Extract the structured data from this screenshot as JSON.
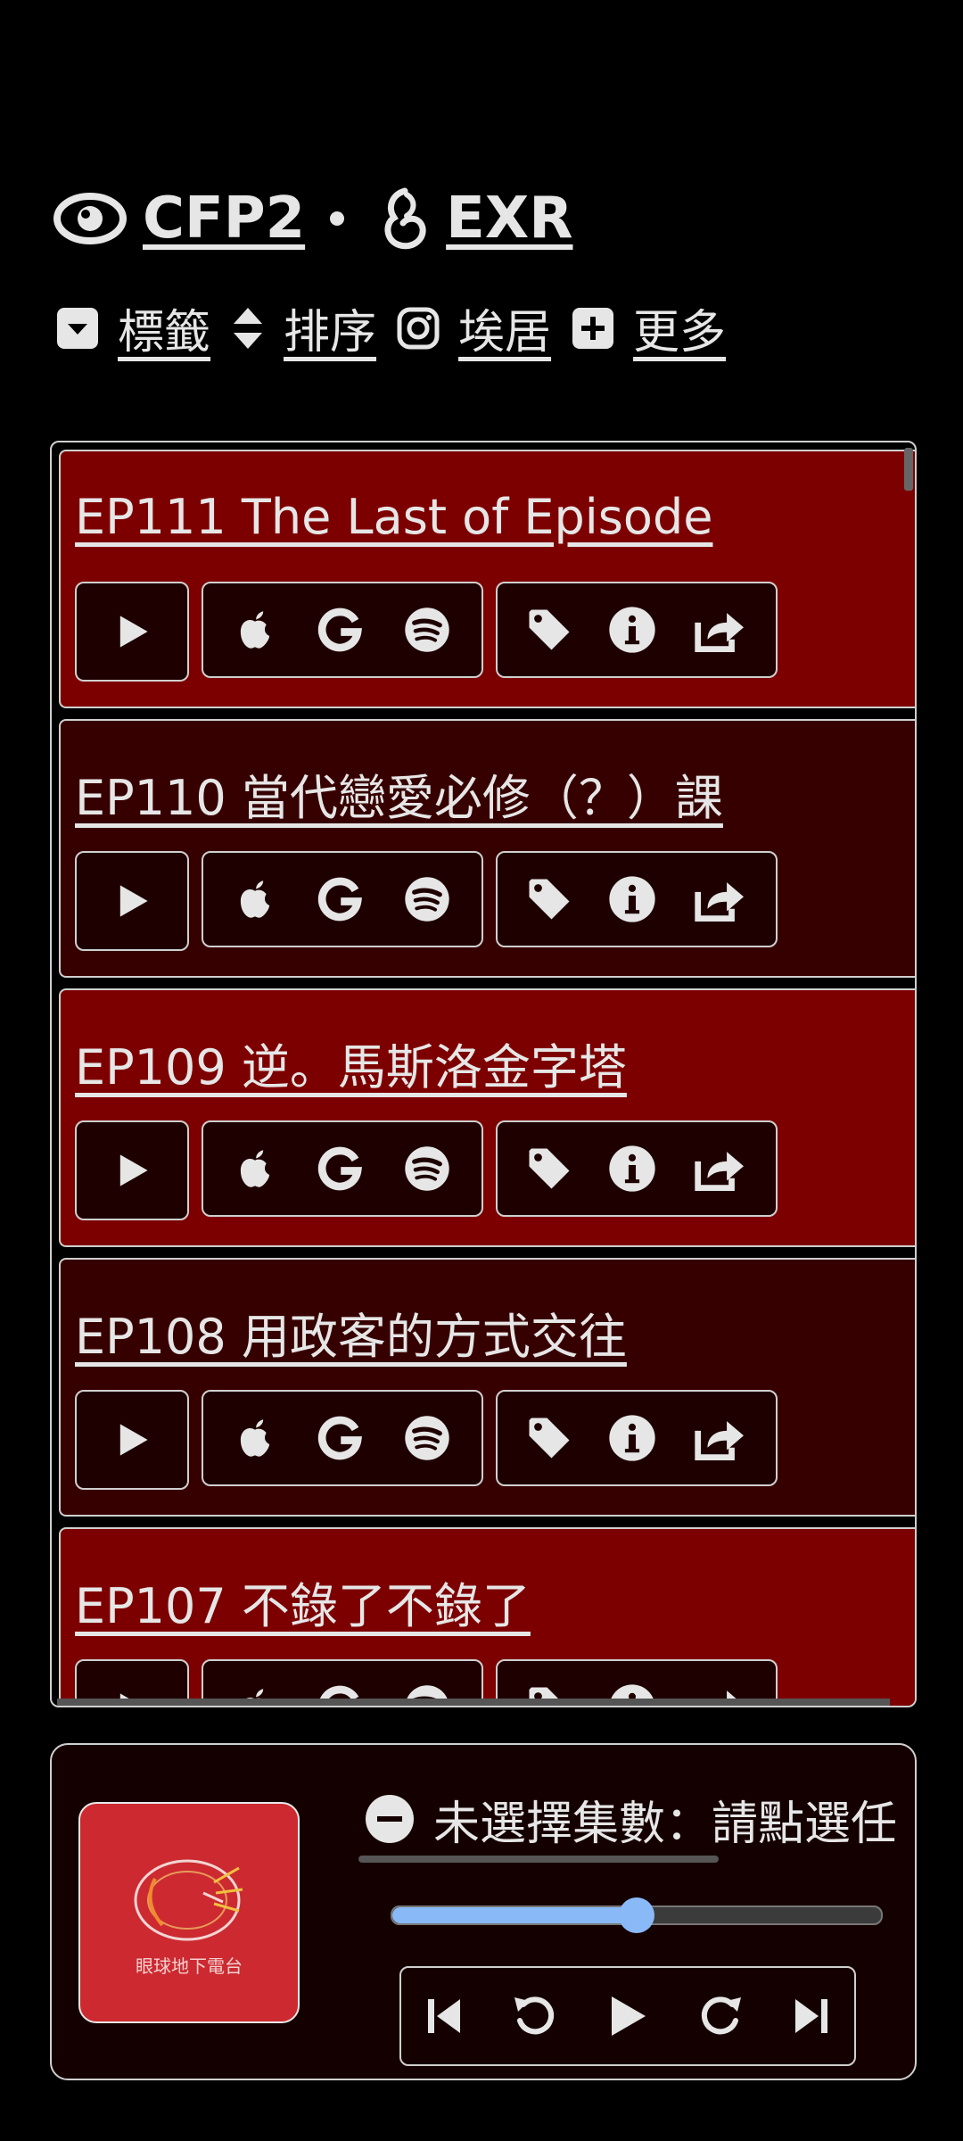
{
  "header": {
    "brand1": "CFP2",
    "brand2": "EXR"
  },
  "toolbar": {
    "tags_label": "標籤",
    "sort_label": "排序",
    "instagram_label": "埃居",
    "more_label": "更多"
  },
  "episodes": [
    {
      "title": "EP111 The Last of Episode"
    },
    {
      "title": "EP110 當代戀愛必修（？）課"
    },
    {
      "title": "EP109 逆。馬斯洛金字塔"
    },
    {
      "title": "EP108 用政客的方式交往"
    },
    {
      "title": "EP107 不錄了不錄了"
    }
  ],
  "player": {
    "cover_text": "眼球地下電台",
    "now_playing": "未選擇集數：請點選任一集數",
    "volume": 0.5
  },
  "icons": {
    "brand1": "eye-icon",
    "brand2": "audible-icon",
    "tags": "caret-square-down-icon",
    "sort": "sort-icon",
    "instagram": "instagram-icon",
    "more": "plus-square-icon"
  },
  "colors": {
    "background": "#000000",
    "episode_red": "#7d0000",
    "episode_dark": "#370000",
    "cover": "#cc2a30",
    "volume_accent": "#8ab9f8"
  }
}
